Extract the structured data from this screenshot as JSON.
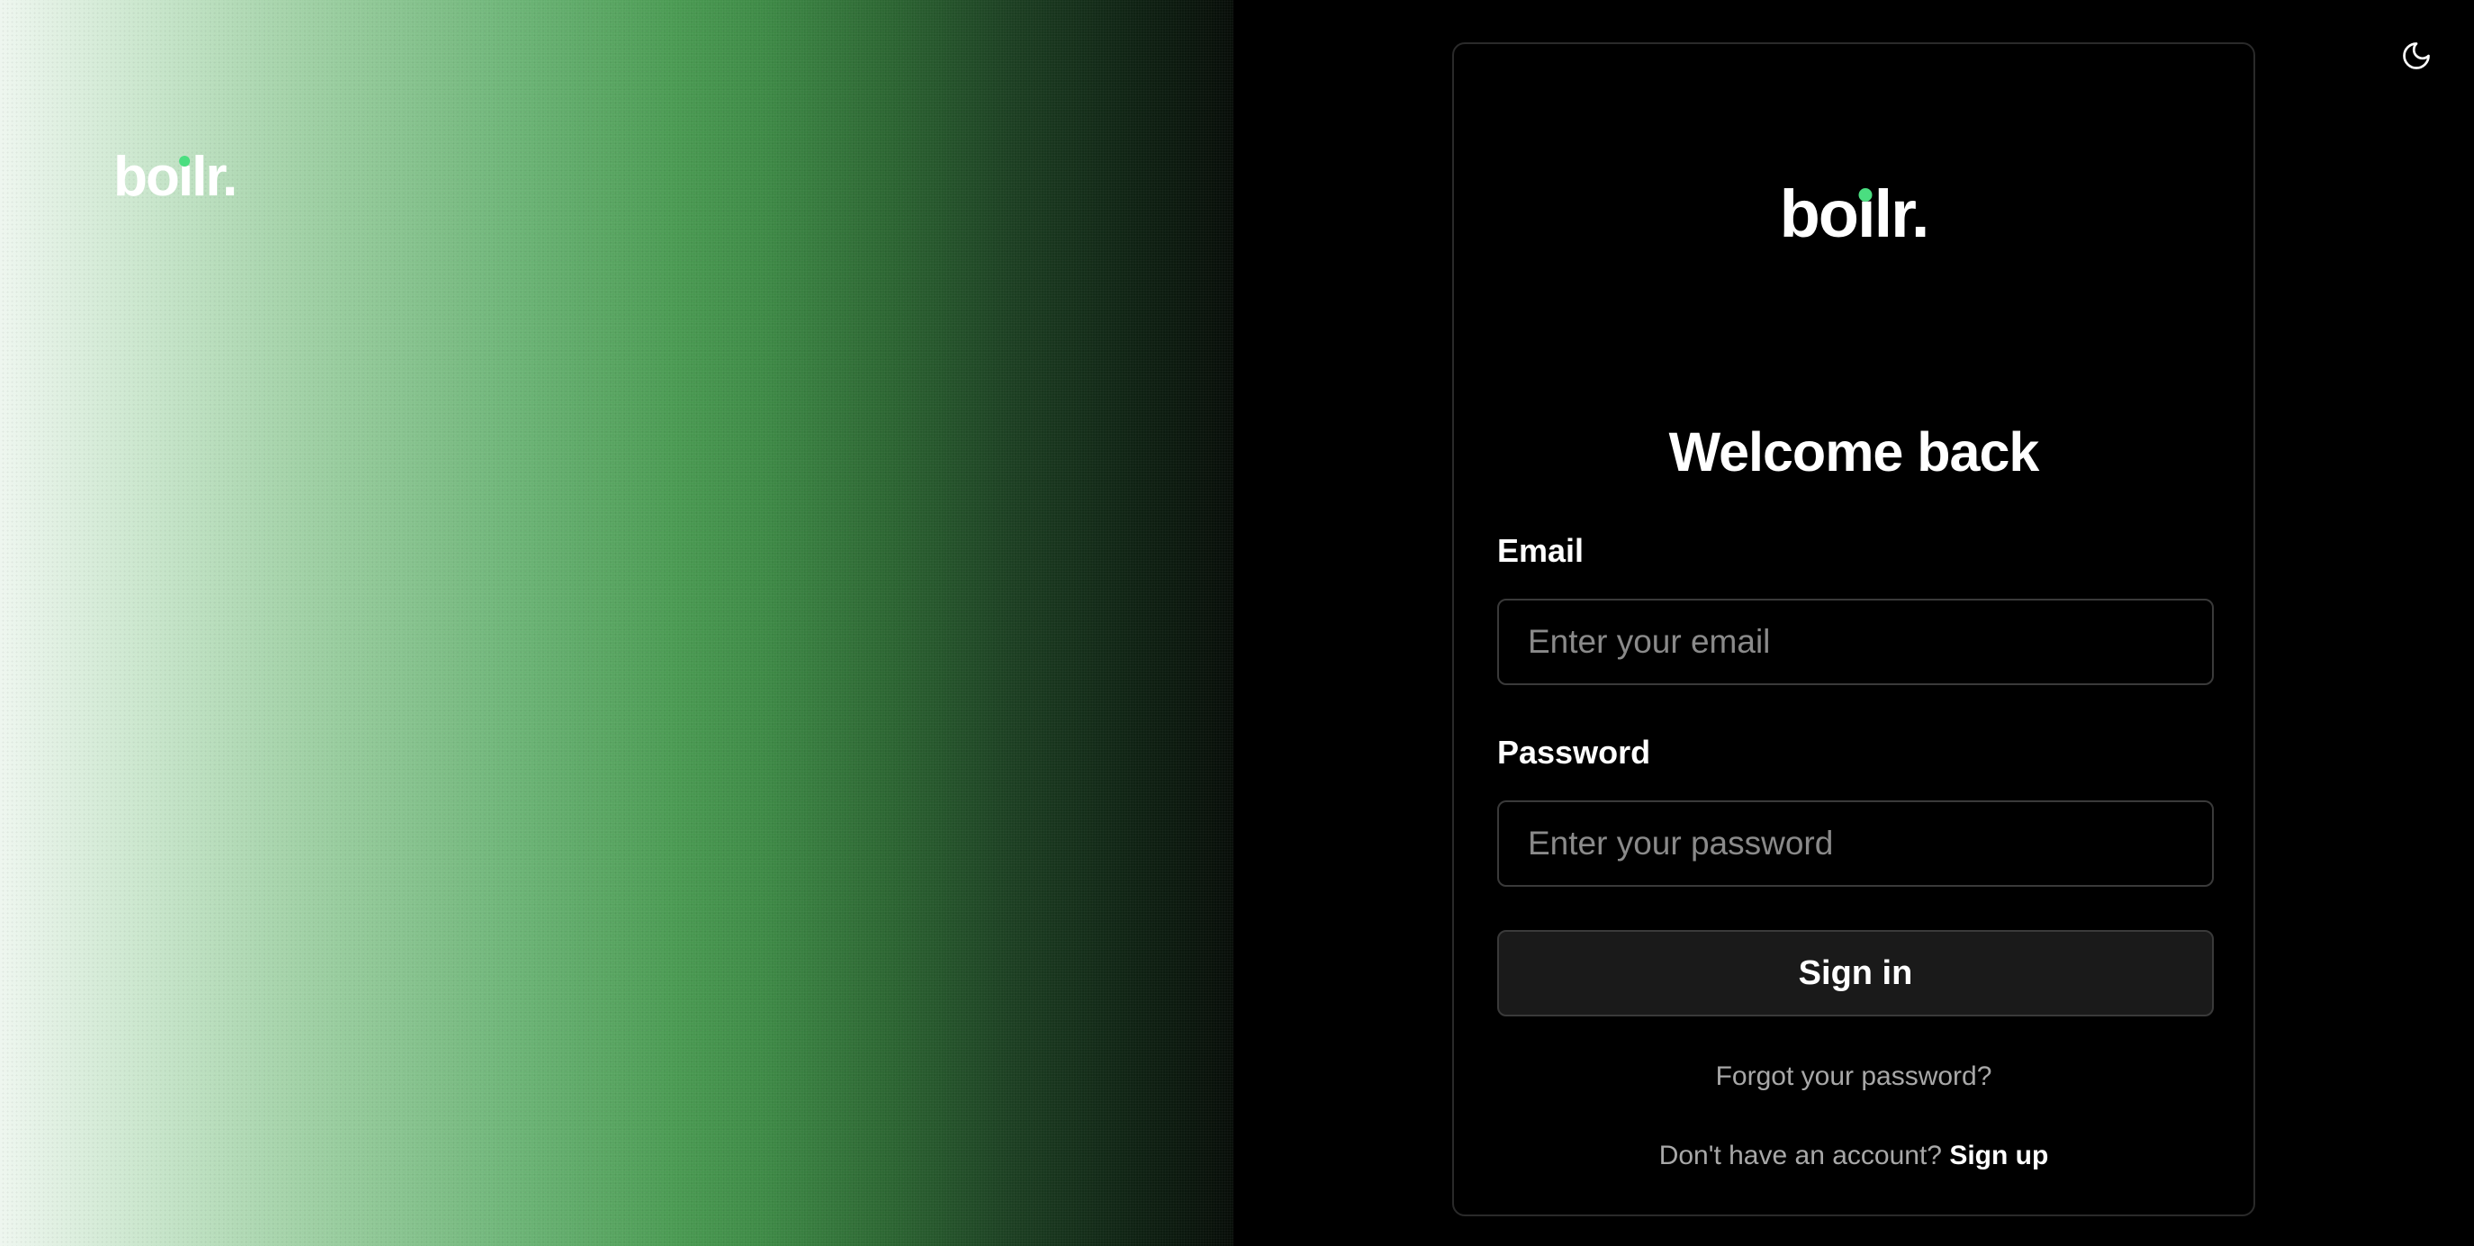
{
  "brand": {
    "logo_text_start": "bo",
    "logo_text_i": "ı",
    "logo_text_end": "lr.",
    "accent_color": "#4ade80"
  },
  "theme_toggle": {
    "icon": "moon-icon"
  },
  "login": {
    "title": "Welcome back",
    "email_label": "Email",
    "email_placeholder": "Enter your email",
    "email_value": "",
    "password_label": "Password",
    "password_placeholder": "Enter your password",
    "password_value": "",
    "submit_label": "Sign in",
    "forgot_link": "Forgot your password?",
    "signup_prompt": "Don't have an account?",
    "signup_link": "Sign up"
  },
  "colors": {
    "background": "#000000",
    "card_border": "#2a2a2a",
    "button_bg": "#1a1a1a",
    "muted_text": "#a8a8a8",
    "gradient_green": "#3e8a46"
  }
}
